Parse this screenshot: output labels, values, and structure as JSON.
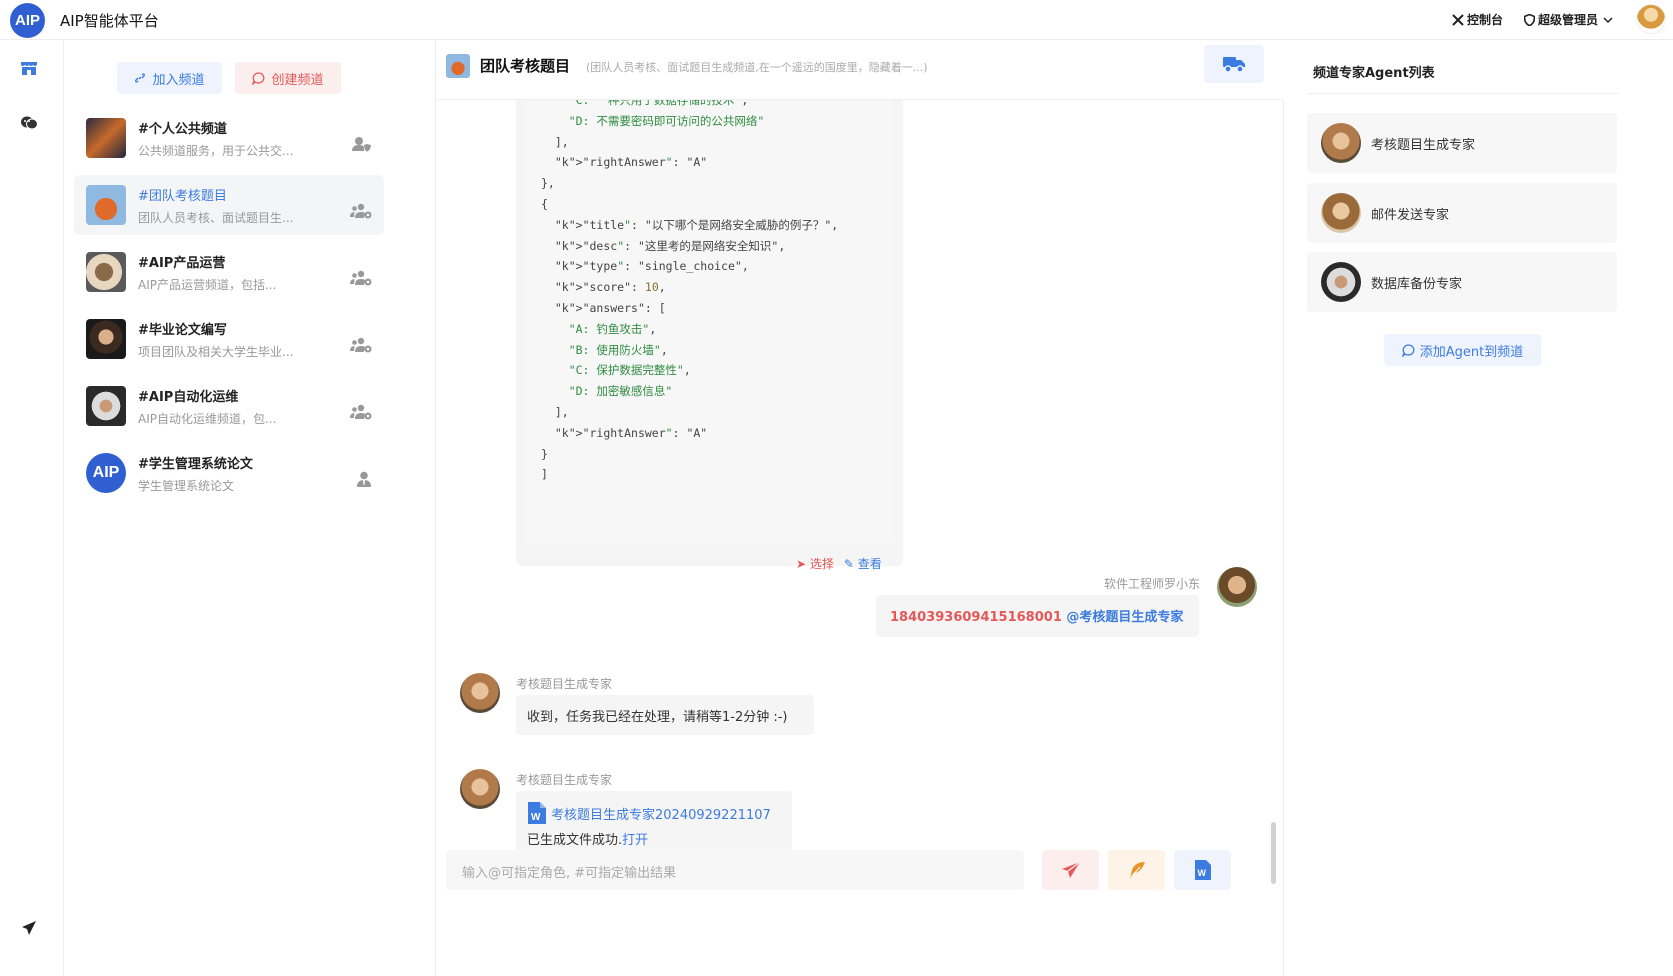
{
  "app": {
    "logo_text": "AIP",
    "title": "AIP智能体平台"
  },
  "topbar": {
    "console_label": "控制台",
    "admin_label": "超级管理员"
  },
  "channels_panel": {
    "join_label": "加入频道",
    "create_label": "创建频道",
    "items": [
      {
        "name": "#个人公共频道",
        "desc": "公共频道服务，用于公共交...",
        "icon": "user-shield-icon"
      },
      {
        "name": "#团队考核题目",
        "desc": "团队人员考核、面试题目生...",
        "icon": "users-gear-icon",
        "active": true
      },
      {
        "name": "#AIP产品运营",
        "desc": "AIP产品运营频道，包括...",
        "icon": "users-gear-icon"
      },
      {
        "name": "#毕业论文编写",
        "desc": "项目团队及相关大学生毕业...",
        "icon": "users-gear-icon"
      },
      {
        "name": "#AIP自动化运维",
        "desc": "AIP自动化运维频道，包...",
        "icon": "users-gear-icon"
      },
      {
        "name": "#学生管理系统论文",
        "desc": "学生管理系统论文",
        "icon": "user-tie-icon",
        "avatar_text": "AIP"
      }
    ]
  },
  "chat": {
    "title": "团队考核题目",
    "subtitle": "(团队人员考核、面试题目生成频道,在一个遥远的国度里，隐藏着一...)",
    "code_lines": [
      "    \"C: 一种只用于数据存储的技术\",",
      "    \"D: 不需要密码即可访问的公共网络\"",
      "  ],",
      "  \"rightAnswer\": \"A\"",
      "},",
      "{",
      "  \"title\": \"以下哪个是网络安全威胁的例子？\",",
      "  \"desc\": \"这里考的是网络安全知识\",",
      "  \"type\": \"single_choice\",",
      "  \"score\": 10,",
      "  \"answers\": [",
      "    \"A: 钓鱼攻击\",",
      "    \"B: 使用防火墙\",",
      "    \"C: 保护数据完整性\",",
      "    \"D: 加密敏感信息\"",
      "  ],",
      "  \"rightAnswer\": \"A\"",
      "}",
      "]"
    ],
    "code_select_label": "选择",
    "code_view_label": "查看",
    "user_msg": {
      "name": "软件工程师罗小东",
      "id_text": "1840393609415168001",
      "mention": "@考核题目生成专家"
    },
    "bot_msg1": {
      "name": "考核题目生成专家",
      "text": "收到，任务我已经在处理，请稍等1-2分钟 :-)"
    },
    "bot_msg2": {
      "name": "考核题目生成专家",
      "file_name": "考核题目生成专家20240929221107",
      "status_text": "已生成文件成功.",
      "open_label": "打开"
    },
    "input_placeholder": "输入@可指定角色, #可指定输出结果"
  },
  "agents_panel": {
    "title": "频道专家Agent列表",
    "items": [
      {
        "name": "考核题目生成专家"
      },
      {
        "name": "邮件发送专家"
      },
      {
        "name": "数据库备份专家"
      }
    ],
    "add_label": "添加Agent到频道"
  },
  "colors": {
    "accent_blue": "#3c7be0",
    "accent_red": "#e45858",
    "accent_orange": "#e8962a"
  }
}
